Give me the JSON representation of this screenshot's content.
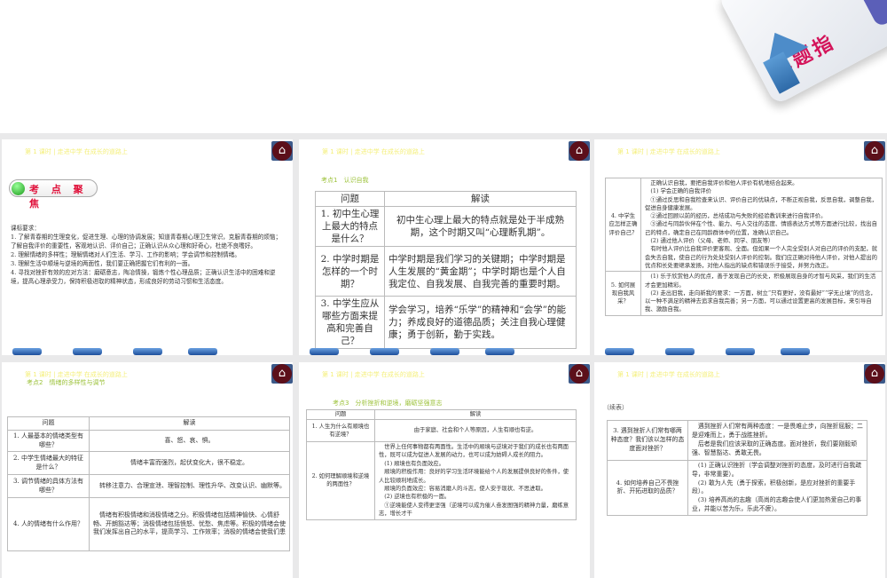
{
  "banner": {
    "title": "解题指"
  },
  "header": "第 1 课时 | 走进中学 在成长的道路上",
  "home_icon": "home-icon",
  "slides": [
    {
      "type": "intro",
      "badge": "考 点 聚 焦",
      "text": "课标要求：\n1. 了解青春期的生理变化，促进生理、心理的协调发展；知道青春期心理卫生常识，克服青春期的烦恼；了解自我评价的重要性，客观地认识、评价自己；正确认识从众心理和好奇心，杜绝不良嗜好。\n2. 理解情绪的多样性；理解情绪对人们生活、学习、工作的影响；学会调节和控制情绪。\n3. 理解生活中顺境与逆境的两面性，我们要正确把握它们有利的一面。\n4. 寻找对挫折有效的应对方法：磨砺意志，陶冶情操，锻炼个性心理品质；正确认识生活中的困难和逆境，提高心理承受力，保持积极进取的精神状态，形成良好的劳动习惯和生活态度。"
    },
    {
      "type": "table",
      "label": "考点1　认识自我",
      "headers": [
        "问题",
        "解读"
      ],
      "rows": [
        [
          "1. 初中生心理上最大的特点是什么？",
          "初中生心理上最大的特点就是处于半成熟期，这个时期又叫“心理断乳期”。"
        ],
        [
          "2. 中学时期是怎样的一个时期？",
          "中学时期是我们学习的关键期；中学时期是人生发展的“黄金期”；中学时期也是个人自我定位、自我发展、自我完善的重要时期。"
        ],
        [
          "3. 中学生应从哪些方面来提高和完善自己？",
          "学会学习，培养“乐学”的精神和“会学”的能力；养成良好的道德品质；关注自我心理健康；勇于创新，勤于实践。"
        ]
      ]
    },
    {
      "type": "table",
      "label": "",
      "headers": [],
      "rows": [
        [
          "4. 中学生应怎样正确评价自己？",
          "　正确认识自我，要把自我评价和他人评价有机地结合起来。\n　(1) 学会正确的自我评价\n　①通过反思和自我检查来认识、评价自己的优缺点，不断正视自我，反思自我，调整自我，促进自身健康发展。\n　②通过回顾以前的经历，总结成功与失败的经验教训来进行自我评价。\n　③通过与同龄伙伴在个性、能力、与人交往的态度、情感表达方式等方面进行比较，找出自己的特点，确定自己在同龄群体中的位置，准确认识自己。\n　(2) 通过他人评价（父母、老师、同学、朋友等）\n　有时他人评价比自我评价更客观、全面。但如果一个人完全受别人对自己的评价的支配，就会失去自我，使自己的行为处处受别人评价的控制。我们应正确对待他人评价，对他人提出的优点和长处要继承发扬，对他人指出的缺点和错误乐于接受，并努力改正。"
        ],
        [
          "5. 如何展现自我风采？",
          "　(1) 乐于欣赏他人的优点，善于发现自己的长处，积极展现自身的才智与风采，我们的生活才会更加精彩。\n　(2) 走出旧我，走向新我的要求：一方面，树立“只有更好，没有最好”“学无止境”的信念，以一种不满足的精神去追求自我完善；另一方面，可以通过设置更高的发展目标，来引导自我、激励自我。"
        ]
      ]
    },
    {
      "type": "table",
      "label": "考点2　情绪的多样性与调节",
      "headers": [
        "问题",
        "解读"
      ],
      "rows": [
        [
          "1. 人最基本的情绪类型有哪些？",
          "喜、怒、哀、惧。"
        ],
        [
          "2. 中学生情绪最大的特征是什么？",
          "情绪丰富而强烈，起伏变化大，很不稳定。"
        ],
        [
          "3. 调节情绪的具体方法有哪些？",
          "　转移注意力、合理宣泄、理智控制、理性升华、改变认识、幽默等。"
        ],
        [
          "4. 人的情绪有什么作用？",
          "　情绪有积极情绪和消极情绪之分。积极情绪包括精神愉快、心情舒畅、开朗豁达等；消极情绪包括愤怒、忧愁、焦虑等。积极的情绪会使我们发挥出自己的水平，提高学习、工作效率；消极的情绪会使我们患"
        ]
      ]
    },
    {
      "type": "table",
      "label": "考点3　分析挫折和逆境，磨砺坚强意志",
      "headers": [
        "问题",
        "解读"
      ],
      "rows": [
        [
          "1. 人生为什么有顺境也有逆境？",
          "由于家庭、社会和个人等原因，人生有顺也有逆。"
        ],
        [
          "2. 如何理解顺境和逆境的两面性？",
          "　世界上任何事物都有两面性。生活中的顺境与逆境对于我们的成长也有两面性，既可以成为促进人发展的动力，也可以成为妨碍人成长的阻力。\n　(1) 顺境也有负面效应。\n　顺境的积极作用：良好的学习生活环境能给个人的发展提供良好的条件，使人比较顺利地成长。\n　顺境的负面效应：容易消磨人的斗志，使人安于现状、不思进取。\n　(2) 逆境也有积极的一面。\n　①逆境能使人变得更坚强（逆境可以成为催人奋发图强的精神力量，磨练意志，增长才干"
        ]
      ]
    },
    {
      "type": "table",
      "label": "（续表）",
      "headers": [],
      "rows": [
        [
          "3. 遇到挫折人们常有哪两种态度？我们该以怎样的态度面对挫折？",
          "　遇到挫折人们常有两种态度：一是畏难止步，向挫折屈服；二是迎难而上，勇于战胜挫折。\n　后者是我们应该采取的正确态度。面对挫折，我们要刚毅顽强、智慧豁达、勇敢无畏。"
        ],
        [
          "4. 如何培养自己不畏挫折、开拓进取的品质？",
          "　(1) 正确认识挫折（学会调整对挫折的态度，及时进行自我疏导，非常重要）。\n　(2) 敢为人先（勇于探索，积极创新，是应对挫折的重要手段）。\n　(3) 培养高尚的志趣（高尚的志趣会使人们更加热爱自己的事业，并能以苦为乐，乐此不疲）。"
        ]
      ]
    }
  ]
}
